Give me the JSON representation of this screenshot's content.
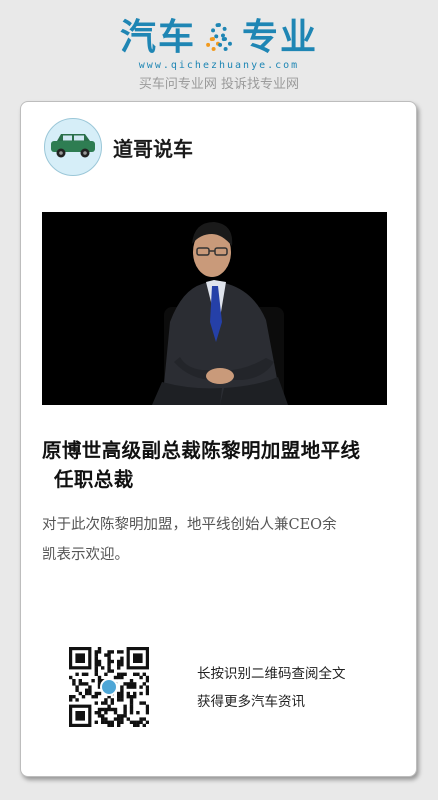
{
  "brand": {
    "title_left": "汽车",
    "title_right": "专业",
    "url": "www.qichezhuanye.com",
    "slogan": "买车问专业网 投诉找专业网",
    "color": "#1f86b4"
  },
  "author": {
    "name": "道哥说车",
    "avatar_icon": "car-icon"
  },
  "article": {
    "title_line1": "原博世高级副总裁陈黎明加盟地平线",
    "title_line2": "任职总裁",
    "summary_line1": "对于此次陈黎明加盟，地平线创始人兼CEO余",
    "summary_line2": "凯表示欢迎。"
  },
  "qr": {
    "line1": "长按识别二维码查阅全文",
    "line2": "获得更多汽车资讯"
  }
}
